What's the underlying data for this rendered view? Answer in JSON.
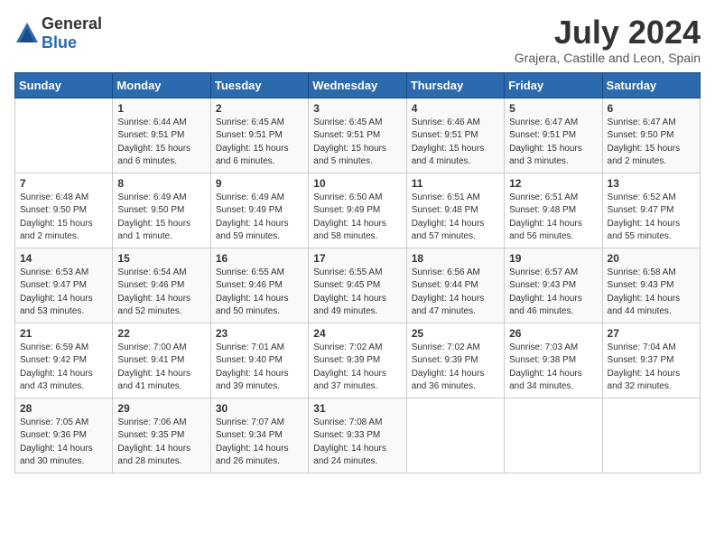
{
  "header": {
    "logo_general": "General",
    "logo_blue": "Blue",
    "month_year": "July 2024",
    "location": "Grajera, Castille and Leon, Spain"
  },
  "days_of_week": [
    "Sunday",
    "Monday",
    "Tuesday",
    "Wednesday",
    "Thursday",
    "Friday",
    "Saturday"
  ],
  "weeks": [
    [
      {
        "day": "",
        "info": ""
      },
      {
        "day": "1",
        "info": "Sunrise: 6:44 AM\nSunset: 9:51 PM\nDaylight: 15 hours\nand 6 minutes."
      },
      {
        "day": "2",
        "info": "Sunrise: 6:45 AM\nSunset: 9:51 PM\nDaylight: 15 hours\nand 6 minutes."
      },
      {
        "day": "3",
        "info": "Sunrise: 6:45 AM\nSunset: 9:51 PM\nDaylight: 15 hours\nand 5 minutes."
      },
      {
        "day": "4",
        "info": "Sunrise: 6:46 AM\nSunset: 9:51 PM\nDaylight: 15 hours\nand 4 minutes."
      },
      {
        "day": "5",
        "info": "Sunrise: 6:47 AM\nSunset: 9:51 PM\nDaylight: 15 hours\nand 3 minutes."
      },
      {
        "day": "6",
        "info": "Sunrise: 6:47 AM\nSunset: 9:50 PM\nDaylight: 15 hours\nand 2 minutes."
      }
    ],
    [
      {
        "day": "7",
        "info": "Sunrise: 6:48 AM\nSunset: 9:50 PM\nDaylight: 15 hours\nand 2 minutes."
      },
      {
        "day": "8",
        "info": "Sunrise: 6:49 AM\nSunset: 9:50 PM\nDaylight: 15 hours\nand 1 minute."
      },
      {
        "day": "9",
        "info": "Sunrise: 6:49 AM\nSunset: 9:49 PM\nDaylight: 14 hours\nand 59 minutes."
      },
      {
        "day": "10",
        "info": "Sunrise: 6:50 AM\nSunset: 9:49 PM\nDaylight: 14 hours\nand 58 minutes."
      },
      {
        "day": "11",
        "info": "Sunrise: 6:51 AM\nSunset: 9:48 PM\nDaylight: 14 hours\nand 57 minutes."
      },
      {
        "day": "12",
        "info": "Sunrise: 6:51 AM\nSunset: 9:48 PM\nDaylight: 14 hours\nand 56 minutes."
      },
      {
        "day": "13",
        "info": "Sunrise: 6:52 AM\nSunset: 9:47 PM\nDaylight: 14 hours\nand 55 minutes."
      }
    ],
    [
      {
        "day": "14",
        "info": "Sunrise: 6:53 AM\nSunset: 9:47 PM\nDaylight: 14 hours\nand 53 minutes."
      },
      {
        "day": "15",
        "info": "Sunrise: 6:54 AM\nSunset: 9:46 PM\nDaylight: 14 hours\nand 52 minutes."
      },
      {
        "day": "16",
        "info": "Sunrise: 6:55 AM\nSunset: 9:46 PM\nDaylight: 14 hours\nand 50 minutes."
      },
      {
        "day": "17",
        "info": "Sunrise: 6:55 AM\nSunset: 9:45 PM\nDaylight: 14 hours\nand 49 minutes."
      },
      {
        "day": "18",
        "info": "Sunrise: 6:56 AM\nSunset: 9:44 PM\nDaylight: 14 hours\nand 47 minutes."
      },
      {
        "day": "19",
        "info": "Sunrise: 6:57 AM\nSunset: 9:43 PM\nDaylight: 14 hours\nand 46 minutes."
      },
      {
        "day": "20",
        "info": "Sunrise: 6:58 AM\nSunset: 9:43 PM\nDaylight: 14 hours\nand 44 minutes."
      }
    ],
    [
      {
        "day": "21",
        "info": "Sunrise: 6:59 AM\nSunset: 9:42 PM\nDaylight: 14 hours\nand 43 minutes."
      },
      {
        "day": "22",
        "info": "Sunrise: 7:00 AM\nSunset: 9:41 PM\nDaylight: 14 hours\nand 41 minutes."
      },
      {
        "day": "23",
        "info": "Sunrise: 7:01 AM\nSunset: 9:40 PM\nDaylight: 14 hours\nand 39 minutes."
      },
      {
        "day": "24",
        "info": "Sunrise: 7:02 AM\nSunset: 9:39 PM\nDaylight: 14 hours\nand 37 minutes."
      },
      {
        "day": "25",
        "info": "Sunrise: 7:02 AM\nSunset: 9:39 PM\nDaylight: 14 hours\nand 36 minutes."
      },
      {
        "day": "26",
        "info": "Sunrise: 7:03 AM\nSunset: 9:38 PM\nDaylight: 14 hours\nand 34 minutes."
      },
      {
        "day": "27",
        "info": "Sunrise: 7:04 AM\nSunset: 9:37 PM\nDaylight: 14 hours\nand 32 minutes."
      }
    ],
    [
      {
        "day": "28",
        "info": "Sunrise: 7:05 AM\nSunset: 9:36 PM\nDaylight: 14 hours\nand 30 minutes."
      },
      {
        "day": "29",
        "info": "Sunrise: 7:06 AM\nSunset: 9:35 PM\nDaylight: 14 hours\nand 28 minutes."
      },
      {
        "day": "30",
        "info": "Sunrise: 7:07 AM\nSunset: 9:34 PM\nDaylight: 14 hours\nand 26 minutes."
      },
      {
        "day": "31",
        "info": "Sunrise: 7:08 AM\nSunset: 9:33 PM\nDaylight: 14 hours\nand 24 minutes."
      },
      {
        "day": "",
        "info": ""
      },
      {
        "day": "",
        "info": ""
      },
      {
        "day": "",
        "info": ""
      }
    ]
  ]
}
